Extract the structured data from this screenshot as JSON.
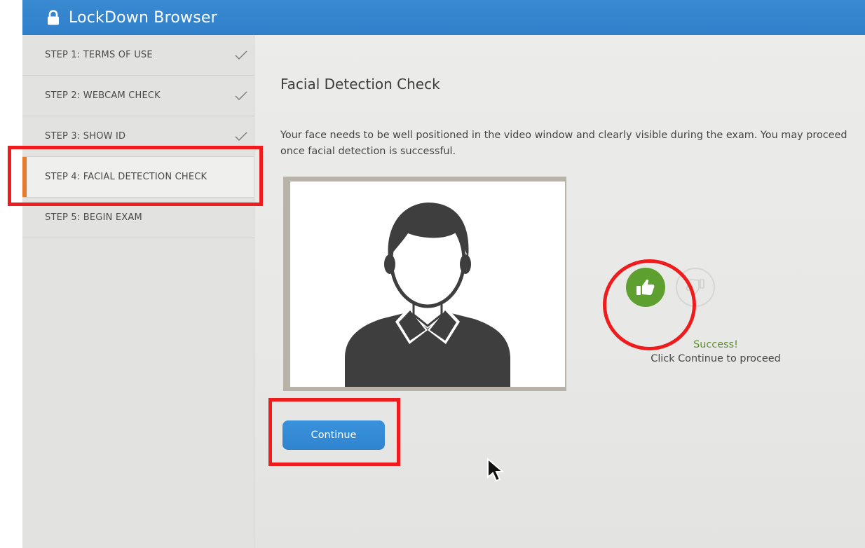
{
  "window": {
    "title": "LockDown Browser",
    "lock_icon": "lock-icon"
  },
  "sidebar": {
    "steps": [
      {
        "label": "STEP 1: TERMS OF USE",
        "completed": true
      },
      {
        "label": "STEP 2: WEBCAM CHECK",
        "completed": true
      },
      {
        "label": "STEP 3: SHOW ID",
        "completed": true
      },
      {
        "label": "STEP 4: FACIAL DETECTION CHECK",
        "completed": false,
        "active": true
      },
      {
        "label": "STEP 5: BEGIN EXAM",
        "completed": false
      }
    ]
  },
  "main": {
    "heading": "Facial Detection Check",
    "description": "Your face needs to be well positioned in the video window and clearly visible during the exam. You may proceed once facial detection is successful.",
    "video_icon": "user-silhouette-icon",
    "status_title": "Success!",
    "status_message": "Click Continue to proceed",
    "continue_label": "Continue"
  },
  "colors": {
    "titlebar": "#2f7fca",
    "active_step_accent": "#e6792b",
    "success_green": "#5ea02f",
    "button_blue": "#2f84cf",
    "annotation_red": "#ee1c1c"
  }
}
